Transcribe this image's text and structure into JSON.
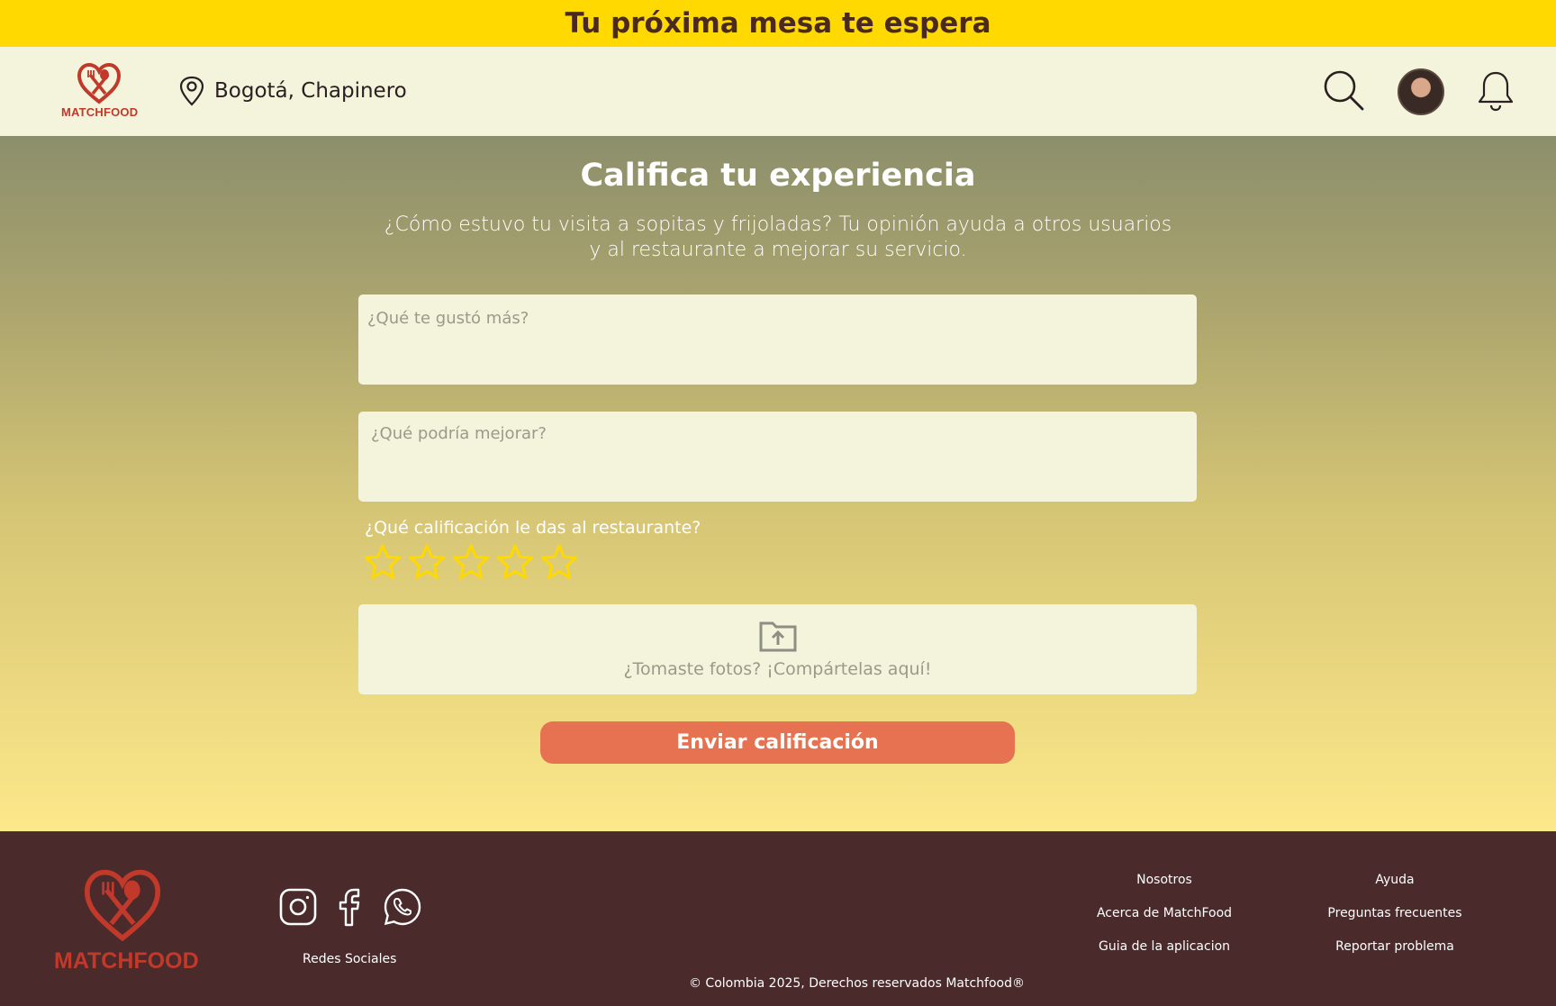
{
  "banner": {
    "text": "Tu próxima mesa te espera"
  },
  "header": {
    "logo_text": "MATCHFOOD",
    "location": "Bogotá, Chapinero",
    "icons": [
      "map-pin-icon",
      "search-icon",
      "avatar",
      "bell-icon"
    ]
  },
  "main": {
    "title": "Califica tu experiencia",
    "subtitle": "¿Cómo estuvo tu visita a sopitas y frijoladas? Tu opinión ayuda a otros usuarios y al restaurante a mejorar su servicio.",
    "liked_placeholder": "¿Qué te gustó más?",
    "improve_placeholder": "¿Qué podría mejorar?",
    "rating_label": "¿Qué calificación le das al restaurante?",
    "rating": {
      "value": 0,
      "max": 5
    },
    "upload_text": "¿Tomaste fotos? ¡Compártelas aquí!",
    "submit_label": "Enviar calificación"
  },
  "footer": {
    "logo_text": "MATCHFOOD",
    "social_label": "Redes Sociales",
    "socials": [
      "instagram-icon",
      "facebook-icon",
      "whatsapp-icon"
    ],
    "col1": {
      "title": "Nosotros",
      "links": [
        "Acerca de MatchFood",
        "Guia de la aplicacion"
      ]
    },
    "col2": {
      "title": "Ayuda",
      "links": [
        "Preguntas frecuentes",
        "Reportar problema"
      ]
    },
    "copyright": "© Colombia 2025, Derechos reservados Matchfood®"
  },
  "colors": {
    "banner": "#FFD900",
    "header_bg": "#F4F4DC",
    "accent_button": "#E77251",
    "star": "#FFD900",
    "footer_bg": "#4A2A2A",
    "brand_red": "#C0392B"
  }
}
